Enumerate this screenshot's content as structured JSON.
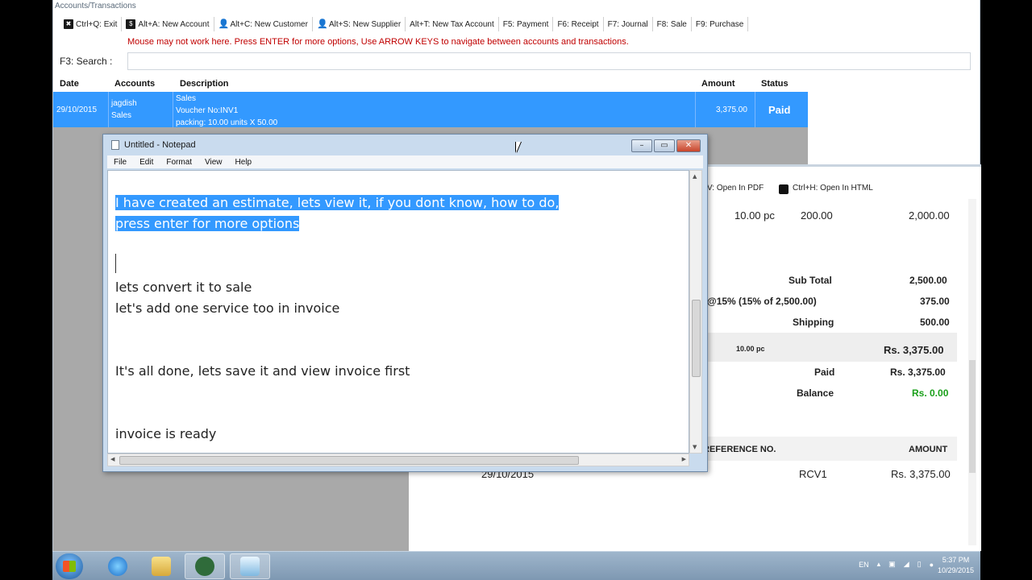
{
  "app": {
    "title": "Accounts/Transactions",
    "toolbar": [
      {
        "label": "Ctrl+Q: Exit",
        "icon": "exit-icon",
        "glyph": "✖"
      },
      {
        "label": "Alt+A: New Account",
        "icon": "dollar-icon",
        "glyph": "$"
      },
      {
        "label": "Alt+C: New Customer",
        "icon": "customer-icon",
        "glyph": "👤"
      },
      {
        "label": "Alt+S: New Supplier",
        "icon": "supplier-icon",
        "glyph": "👤"
      },
      {
        "label": "Alt+T: New Tax Account",
        "icon": "",
        "glyph": ""
      },
      {
        "label": "F5: Payment",
        "icon": "",
        "glyph": ""
      },
      {
        "label": "F6: Receipt",
        "icon": "",
        "glyph": ""
      },
      {
        "label": "F7: Journal",
        "icon": "",
        "glyph": ""
      },
      {
        "label": "F8: Sale",
        "icon": "",
        "glyph": ""
      },
      {
        "label": "F9: Purchase",
        "icon": "",
        "glyph": ""
      }
    ],
    "notice": "Mouse may not work here. Press ENTER for more options, Use ARROW KEYS to navigate between accounts and transactions.",
    "search_label": "F3: Search :",
    "search_value": "",
    "columns": {
      "date": "Date",
      "accounts": "Accounts",
      "description": "Description",
      "amount": "Amount",
      "status": "Status"
    },
    "row": {
      "date": "29/10/2015",
      "account_1": "jagdish",
      "account_2": "Sales",
      "desc_1": "Sales",
      "desc_2": "Voucher No:INV1",
      "desc_3": "packing: 10.00 units X  50.00",
      "amount": "3,375.00",
      "status": "Paid"
    }
  },
  "invoice": {
    "open_pdf": "V: Open In PDF",
    "open_html": "Ctrl+H: Open In HTML",
    "item_qty": "10.00 pc",
    "item_rate": "200.00",
    "item_amount": "2,000.00",
    "subtotal_label": "Sub Total",
    "subtotal_value": "2,500.00",
    "tax_label": "@15% (15% of 2,500.00)",
    "tax_value": "375.00",
    "shipping_label": "Shipping",
    "shipping_value": "500.00",
    "total_qty": "10.00 pc",
    "total_value": "Rs. 3,375.00",
    "paid_label": "Paid",
    "paid_value": "Rs. 3,375.00",
    "balance_label": "Balance",
    "balance_value": "Rs. 0.00",
    "ref_header": "REFERENCE NO.",
    "amount_header": "AMOUNT",
    "receipt_date": "29/10/2015",
    "receipt_ref": "RCV1",
    "receipt_amount": "Rs. 3,375.00"
  },
  "notepad": {
    "title": "Untitled - Notepad",
    "menu": [
      "File",
      "Edit",
      "Format",
      "View",
      "Help"
    ],
    "lines": [
      {
        "text": "I have created an estimate, lets view it, if you dont know, how to do,",
        "selected": true
      },
      {
        "text": "press enter for more options",
        "selected": true
      },
      {
        "text": "lets convert it to sale",
        "selected": false
      },
      {
        "text": "let's add one service too in invoice",
        "selected": false
      },
      {
        "text": "It's all done, lets save it and view invoice first",
        "selected": false
      },
      {
        "text": "invoice is ready",
        "selected": false
      }
    ]
  },
  "taskbar": {
    "language": "EN",
    "time": "5:37 PM",
    "date": "10/29/2015"
  },
  "colors": {
    "selection": "#3399ff",
    "notice": "#c00000",
    "balance": "#1aa01a"
  }
}
